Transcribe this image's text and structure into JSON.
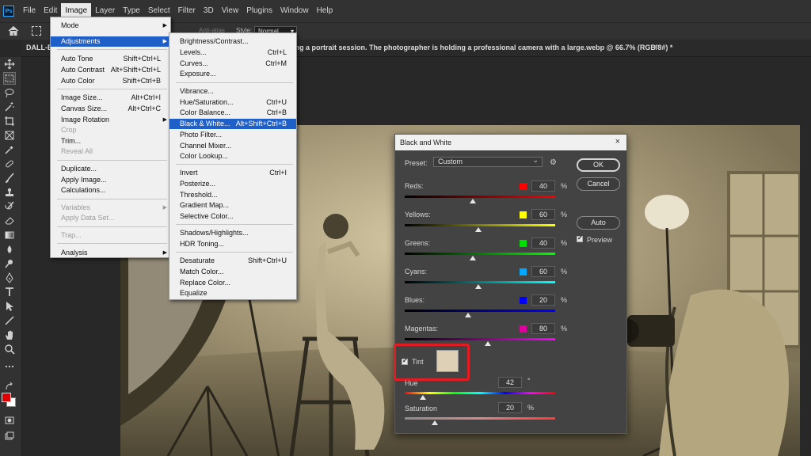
{
  "app": {
    "logo_text": "Ps",
    "menus": [
      "File",
      "Edit",
      "Image",
      "Layer",
      "Type",
      "Select",
      "Filter",
      "3D",
      "View",
      "Plugins",
      "Window",
      "Help"
    ],
    "active_menu": "Image"
  },
  "options_bar": {
    "antialias_label": "Anti-alias",
    "style_label": "Style:",
    "style_value": "Normal"
  },
  "document": {
    "tab_left": "DALL-E",
    "tab_right": "ing a portrait session. The photographer is holding a professional camera with a large.webp @ 66.7% (RGB/8#) *",
    "tab_close": "×"
  },
  "image_menu": {
    "items": [
      {
        "label": "Mode",
        "shortcut": "",
        "submenu": true,
        "disabled": false
      },
      {
        "label": "Adjustments",
        "shortcut": "",
        "submenu": true,
        "disabled": false,
        "highlighted": true
      },
      {
        "label": "Auto Tone",
        "shortcut": "Shift+Ctrl+L",
        "disabled": false
      },
      {
        "label": "Auto Contrast",
        "shortcut": "Alt+Shift+Ctrl+L",
        "disabled": false
      },
      {
        "label": "Auto Color",
        "shortcut": "Shift+Ctrl+B",
        "disabled": false
      },
      {
        "label": "Image Size...",
        "shortcut": "Alt+Ctrl+I",
        "disabled": false
      },
      {
        "label": "Canvas Size...",
        "shortcut": "Alt+Ctrl+C",
        "disabled": false
      },
      {
        "label": "Image Rotation",
        "shortcut": "",
        "submenu": true,
        "disabled": false
      },
      {
        "label": "Crop",
        "shortcut": "",
        "disabled": true
      },
      {
        "label": "Trim...",
        "shortcut": "",
        "disabled": false
      },
      {
        "label": "Reveal All",
        "shortcut": "",
        "disabled": true
      },
      {
        "label": "Duplicate...",
        "shortcut": "",
        "disabled": false
      },
      {
        "label": "Apply Image...",
        "shortcut": "",
        "disabled": false
      },
      {
        "label": "Calculations...",
        "shortcut": "",
        "disabled": false
      },
      {
        "label": "Variables",
        "shortcut": "",
        "submenu": true,
        "disabled": true
      },
      {
        "label": "Apply Data Set...",
        "shortcut": "",
        "disabled": true
      },
      {
        "label": "Trap...",
        "shortcut": "",
        "disabled": true
      },
      {
        "label": "Analysis",
        "shortcut": "",
        "submenu": true,
        "disabled": false
      }
    ]
  },
  "adjust_menu": {
    "items": [
      {
        "label": "Brightness/Contrast...",
        "shortcut": ""
      },
      {
        "label": "Levels...",
        "shortcut": "Ctrl+L"
      },
      {
        "label": "Curves...",
        "shortcut": "Ctrl+M"
      },
      {
        "label": "Exposure...",
        "shortcut": ""
      },
      {
        "label": "Vibrance...",
        "shortcut": ""
      },
      {
        "label": "Hue/Saturation...",
        "shortcut": "Ctrl+U"
      },
      {
        "label": "Color Balance...",
        "shortcut": "Ctrl+B"
      },
      {
        "label": "Black & White...",
        "shortcut": "Alt+Shift+Ctrl+B",
        "highlighted": true
      },
      {
        "label": "Photo Filter...",
        "shortcut": ""
      },
      {
        "label": "Channel Mixer...",
        "shortcut": ""
      },
      {
        "label": "Color Lookup...",
        "shortcut": ""
      },
      {
        "label": "Invert",
        "shortcut": "Ctrl+I"
      },
      {
        "label": "Posterize...",
        "shortcut": ""
      },
      {
        "label": "Threshold...",
        "shortcut": ""
      },
      {
        "label": "Gradient Map...",
        "shortcut": ""
      },
      {
        "label": "Selective Color...",
        "shortcut": ""
      },
      {
        "label": "Shadows/Highlights...",
        "shortcut": ""
      },
      {
        "label": "HDR Toning...",
        "shortcut": ""
      },
      {
        "label": "Desaturate",
        "shortcut": "Shift+Ctrl+U"
      },
      {
        "label": "Match Color...",
        "shortcut": ""
      },
      {
        "label": "Replace Color...",
        "shortcut": ""
      },
      {
        "label": "Equalize",
        "shortcut": ""
      }
    ]
  },
  "dialog": {
    "title": "Black and White",
    "close": "×",
    "preset_label": "Preset:",
    "preset_value": "Custom",
    "ok_label": "OK",
    "cancel_label": "Cancel",
    "auto_label": "Auto",
    "preview_label": "Preview",
    "preview_checked": true,
    "percent_sign": "%",
    "degree_sign": "°",
    "sliders": [
      {
        "label": "Reds:",
        "value": "40",
        "color": "#ff0000",
        "position": 0.45
      },
      {
        "label": "Yellows:",
        "value": "60",
        "color": "#ffff00",
        "position": 0.49
      },
      {
        "label": "Greens:",
        "value": "40",
        "color": "#00e000",
        "position": 0.45
      },
      {
        "label": "Cyans:",
        "value": "60",
        "color": "#00a8ff",
        "position": 0.49
      },
      {
        "label": "Blues:",
        "value": "20",
        "color": "#0000ff",
        "position": 0.42
      },
      {
        "label": "Magentas:",
        "value": "80",
        "color": "#e000a0",
        "position": 0.55
      }
    ],
    "tint": {
      "label": "Tint",
      "checked": true,
      "color": "#ddd0b7",
      "hue_label": "Hue",
      "hue_value": "42",
      "hue_position": 0.12,
      "saturation_label": "Saturation",
      "saturation_value": "20",
      "saturation_position": 0.2
    }
  }
}
